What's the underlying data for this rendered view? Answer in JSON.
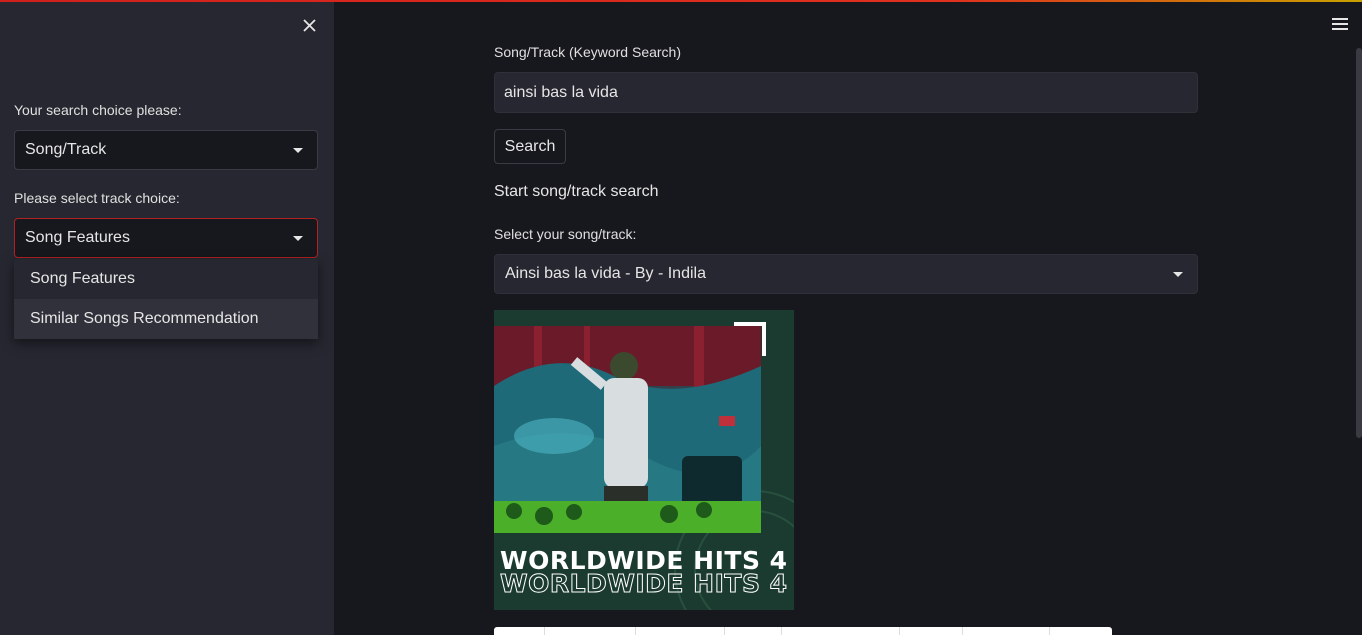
{
  "sidebar": {
    "search_choice_label": "Your search choice please:",
    "search_choice_value": "Song/Track",
    "track_choice_label": "Please select track choice:",
    "track_choice_value": "Song Features",
    "dropdown_options": [
      "Song Features",
      "Similar Songs Recommendation"
    ]
  },
  "main": {
    "keyword_label": "Song/Track (Keyword Search)",
    "keyword_value": "ainsi bas la vida",
    "search_button": "Search",
    "status": "Start song/track search",
    "select_label": "Select your song/track:",
    "select_value": "Ainsi bas la vida - By - Indila",
    "album_title": "WORLDWIDE HITS 4"
  },
  "colors": {
    "background": "#17181d",
    "sidebar": "#262730",
    "focus_border": "#b22222"
  }
}
